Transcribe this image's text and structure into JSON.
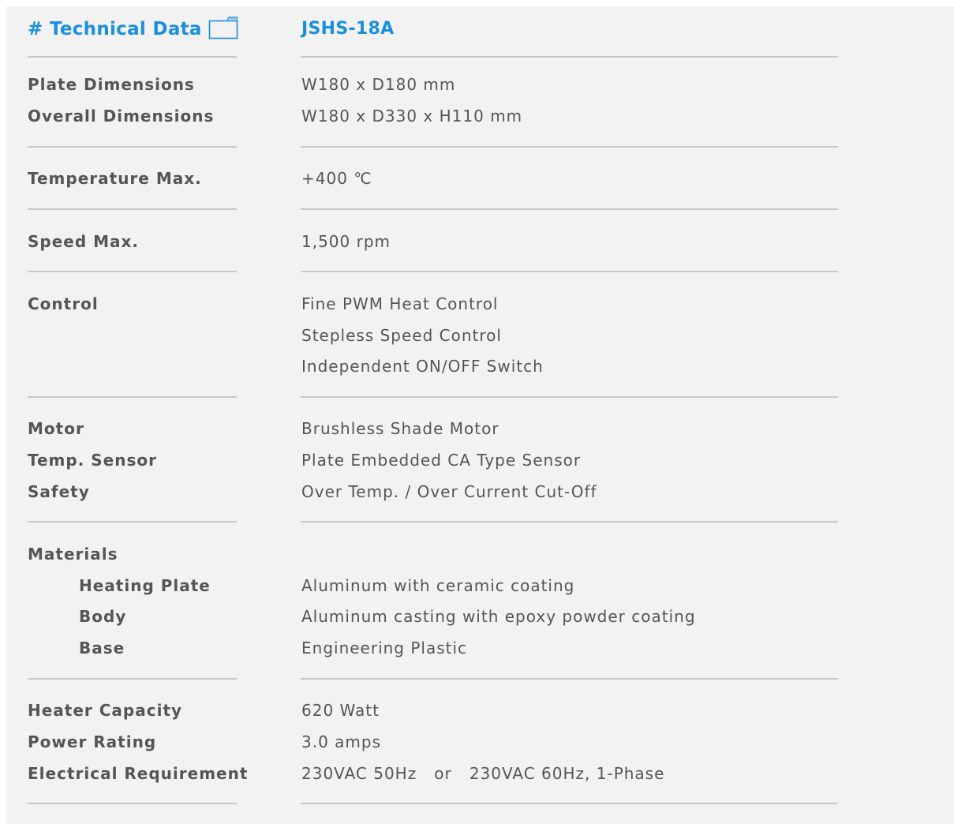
{
  "header": {
    "title": "# Technical Data",
    "model": "JSHS-18A",
    "icon": "folder-icon",
    "accent_color": "#1a8fdc"
  },
  "specs": {
    "plate_dimensions": {
      "label": "Plate Dimensions",
      "value": "W180 x D180 mm"
    },
    "overall_dimensions": {
      "label": "Overall Dimensions",
      "value": "W180 x D330 x H110 mm"
    },
    "temperature_max": {
      "label": "Temperature Max.",
      "value": "+400 ℃"
    },
    "speed_max": {
      "label": "Speed  Max.",
      "value": "1,500 rpm"
    },
    "control": {
      "label": "Control",
      "values": [
        "Fine PWM Heat Control",
        "Stepless Speed Control",
        "Independent ON/OFF Switch"
      ]
    },
    "motor": {
      "label": "Motor",
      "value": "Brushless Shade Motor"
    },
    "temp_sensor": {
      "label": "Temp. Sensor",
      "value": "Plate Embedded CA Type Sensor"
    },
    "safety": {
      "label": "Safety",
      "value": "Over Temp.  /  Over Current Cut-Off"
    },
    "materials": {
      "label": "Materials",
      "heating_plate": {
        "label": "Heating Plate",
        "value": "Aluminum with ceramic coating"
      },
      "body": {
        "label": "Body",
        "value": "Aluminum casting with epoxy powder coating"
      },
      "base": {
        "label": "Base",
        "value": "Engineering Plastic"
      }
    },
    "heater_capacity": {
      "label": "Heater Capacity",
      "value": "620 Watt"
    },
    "power_rating": {
      "label": "Power Rating",
      "value": "3.0 amps"
    },
    "electrical_requirement": {
      "label": "Electrical Requirement",
      "value": "230VAC 50Hz   or   230VAC 60Hz, 1-Phase"
    }
  }
}
